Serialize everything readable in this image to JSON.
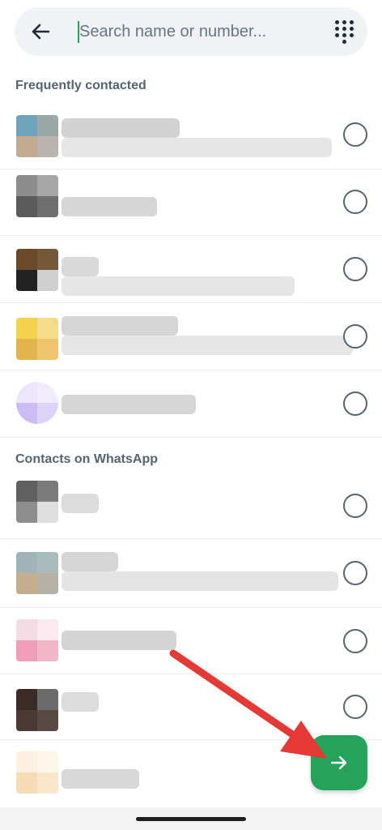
{
  "search": {
    "placeholder": "Search name or number..."
  },
  "sections": {
    "frequent": "Frequently contacted",
    "whatsapp": "Contacts on WhatsApp"
  },
  "icons": {
    "back": "arrow-left-icon",
    "dialpad": "dialpad-icon",
    "next": "arrow-right-icon"
  },
  "colors": {
    "accent": "#25a35a",
    "annotation_arrow": "#e53935"
  }
}
